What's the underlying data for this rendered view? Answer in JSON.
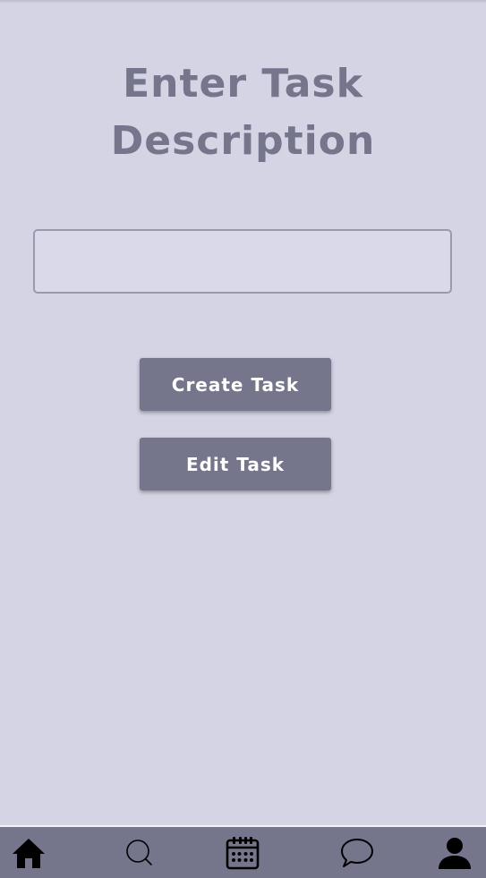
{
  "header": {
    "title_line1": "Enter Task",
    "title_line2": "Description"
  },
  "task_input": {
    "value": "",
    "placeholder": ""
  },
  "actions": {
    "create_label": "Create Task",
    "edit_label": "Edit Task"
  },
  "bottom_nav": {
    "items": [
      {
        "icon": "home-icon"
      },
      {
        "icon": "search-icon"
      },
      {
        "icon": "calendar-icon"
      },
      {
        "icon": "chat-icon"
      },
      {
        "icon": "profile-icon"
      }
    ]
  },
  "colors": {
    "background": "#d4d4e5",
    "accent": "#75758c",
    "button_text": "#ffffff",
    "nav_icon": "#000000"
  }
}
